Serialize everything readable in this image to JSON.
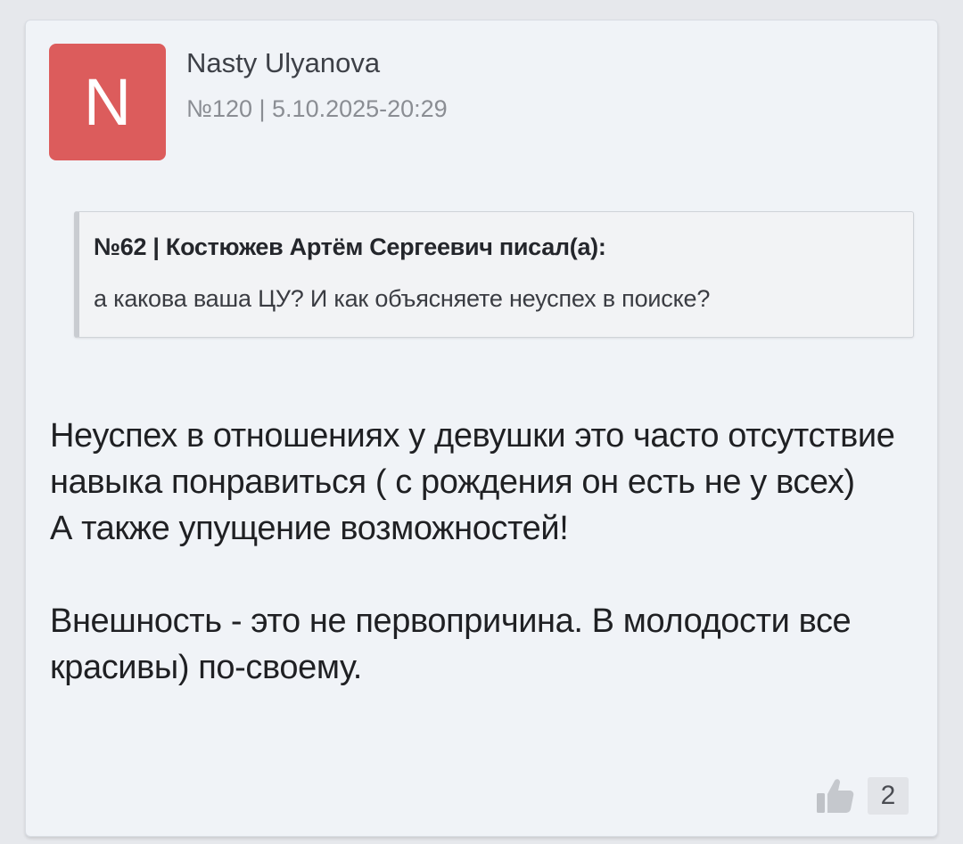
{
  "post": {
    "avatar_letter": "N",
    "avatar_color": "#dc5c5c",
    "author_name": "Nasty Ulyanova",
    "meta": "№120 | 5.10.2025-20:29",
    "quote": {
      "header": "№62 | Костюжев Артём Сергеевич писал(а):",
      "text": "а какова ваша ЦУ? И как объясняете неуспех в поиске?"
    },
    "body": {
      "line1": "Неуспех в отношениях у девушки это часто отсутствие навыка понравиться ( с рождения он есть не у всех)",
      "line2": "А также упущение возможностей!",
      "line3": "Внешность - это не первопричина. В молодости все красивы) по-своему."
    },
    "likes": {
      "icon": "thumbs-up-icon",
      "count": "2"
    }
  }
}
